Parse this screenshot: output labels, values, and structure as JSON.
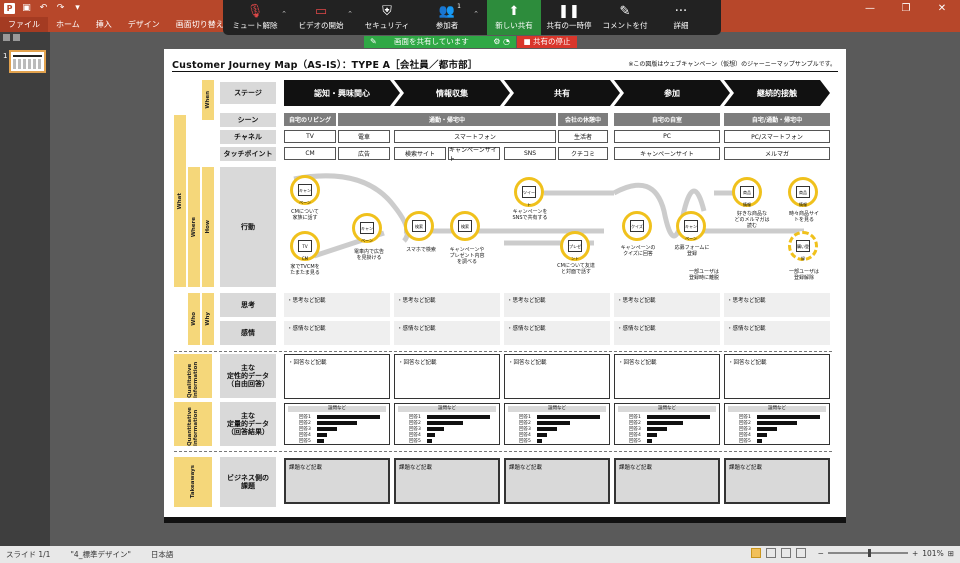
{
  "quick_access": {
    "undo": "↶",
    "redo": "↷"
  },
  "ribbon_tabs": [
    "ファイル",
    "ホーム",
    "挿入",
    "デザイン",
    "画面切り替え",
    "アニ"
  ],
  "zoom_toolbar": {
    "mute": "ミュート解除",
    "video": "ビデオの開始",
    "security": "セキュリティ",
    "participants": "参加者",
    "participants_count": "1",
    "new_share": "新しい共有",
    "pause_share": "共有の一時停",
    "comment": "コメントを付",
    "more": "詳細"
  },
  "share_banner": "画面を共有しています",
  "stop_share": "共有の停止",
  "thumbnail": {
    "number": "1"
  },
  "slide": {
    "title": "Customer Journey Map（AS-IS）：TYPE A［会社員／都市部］",
    "note": "※この図版はウェブキャンペーン（仮想）のジャーニーマップサンプルです。",
    "side_labels": {
      "when": "When",
      "what": "What",
      "where": "Where",
      "how": "How",
      "who": "Who",
      "why": "Why",
      "qualitative": "Qualitative information",
      "quantitative": "Quantitative information",
      "takeaways": "Takeaways"
    },
    "row_labels": {
      "stage": "ステージ",
      "scene": "シーン",
      "channel": "チャネル",
      "touchpoint": "タッチポイント",
      "action": "行動",
      "thinking": "思考",
      "emotion": "感情",
      "qual": "主な\n定性的データ\n（自由回答）",
      "quan": "主な\n定量的データ\n（回答結果）",
      "business": "ビジネス側の\n課題"
    },
    "stages": [
      "認知・興味関心",
      "情報収集",
      "共有",
      "参加",
      "継続的接触"
    ],
    "scenes": [
      "自宅のリビング",
      "通勤・帰宅中",
      "会社の休憩中",
      "自宅の自室",
      "自宅/通勤・帰宅中"
    ],
    "channels": [
      "TV",
      "電車",
      "スマートフォン",
      "生活者",
      "PC",
      "PC/スマートフォン"
    ],
    "touchpoints": [
      "CM",
      "広告",
      "検索サイト",
      "キャンペーンサイト",
      "SNS",
      "クチコミ",
      "キャンペーンサイト",
      "メルマガ"
    ],
    "actions": {
      "a1": "CMについて\n家族に話す",
      "a1_icon": "キャン\nペーン",
      "a2": "家でTVCMを\nたまたま見る",
      "a2_icon": "TV CM",
      "a3": "電車内で広告\nを見掛ける",
      "a3_icon": "キャン\nペーン",
      "a4": "スマホで検索",
      "a4_icon": "検索",
      "a5": "キャンペーンや\nプレゼント内容\nを調べる",
      "a5_icon": "検索",
      "a6": "キャンペーンを\nSNSで共有する",
      "a6_icon1": "いいね",
      "a6_icon2": "ツイート",
      "a7": "CMについて友達\nと対面で話す",
      "a7_icon": "プレゼント",
      "a8": "キャンペーンの\nクイズに回答",
      "a8_icon": "クイズ",
      "a9": "応募フォームに\n登録",
      "a9_icon": "キャンペーン",
      "a10": "一部ユーザは\n登録時に離脱",
      "a11": "好きな商品な\nどのメルマガは\n読む",
      "a11_icon": "商品\n情報",
      "a12": "時々商品サイ\nトを見る",
      "a12_icon": "商品\n情報",
      "a13": "一部ユーザは\n登録解除",
      "a13_icon": "購い登録"
    },
    "thinking": [
      "・思考など記載",
      "・思考など記載",
      "・思考など記載",
      "・思考など記載",
      "・思考など記載"
    ],
    "emotion": [
      "・感情など記載",
      "・感情など記載",
      "・感情など記載",
      "・感情など記載",
      "・感情など記載"
    ],
    "qual": [
      "・回答など記載",
      "・回答など記載",
      "・回答など記載",
      "・回答など記載",
      "・回答など記載"
    ],
    "quan_header": "設問など",
    "quan_rows": [
      "回答1",
      "回答2",
      "回答3",
      "回答4",
      "回答5"
    ],
    "quan_values": [
      [
        0.95,
        0.6,
        0.3,
        0.15,
        0.1
      ],
      [
        0.95,
        0.55,
        0.25,
        0.12,
        0.08
      ],
      [
        0.95,
        0.5,
        0.3,
        0.15,
        0.08
      ],
      [
        0.95,
        0.55,
        0.3,
        0.15,
        0.08
      ],
      [
        0.95,
        0.6,
        0.3,
        0.15,
        0.08
      ]
    ],
    "takeaways": [
      "課題など記載",
      "課題など記載",
      "課題など記載",
      "課題など記載",
      "課題など記載"
    ]
  },
  "status": {
    "slide": "スライド 1/1",
    "theme": "\"4_標準デザイン\"",
    "lang": "日本語",
    "zoom": "101%"
  },
  "colors": {
    "accent": "#f0c11c",
    "ppt": "#b7472a",
    "share_green": "#2fa845",
    "stop_red": "#d9362b"
  }
}
